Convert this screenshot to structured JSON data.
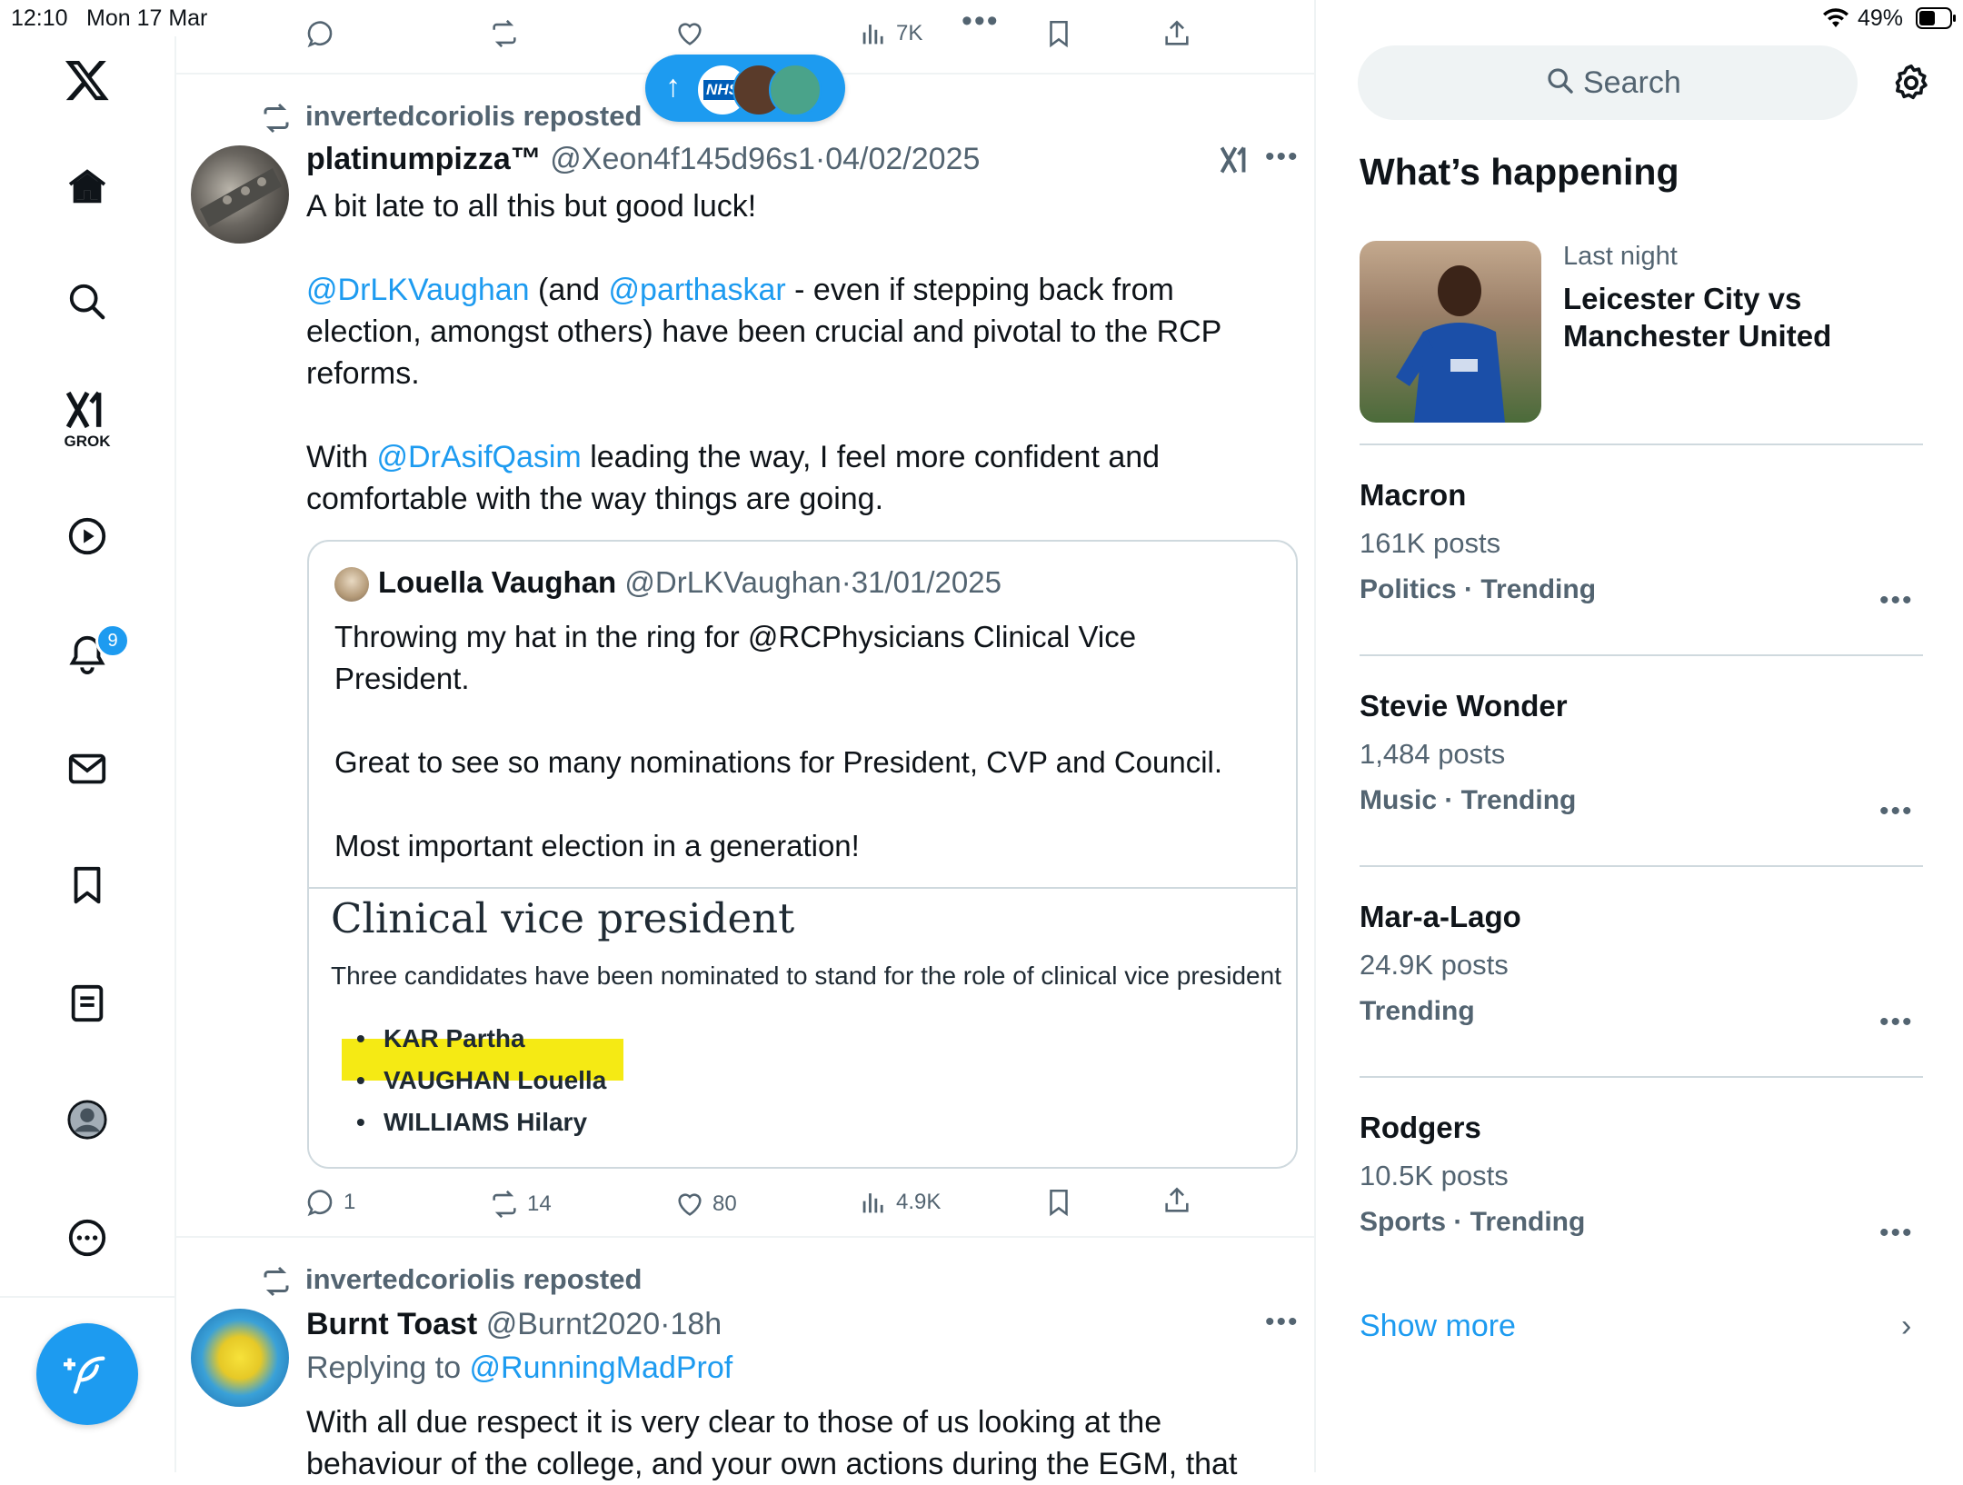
{
  "status_bar": {
    "time": "12:10",
    "date": "Mon 17 Mar",
    "battery": "49%"
  },
  "sidebar": {
    "grok_label": "GROK",
    "notifications_badge": "9"
  },
  "top_tweet_actions": {
    "views": "7K"
  },
  "new_posts_pill": {
    "arrow": "↑",
    "badge_text": "NHS"
  },
  "tweet1": {
    "repost_label": "invertedcoriolis reposted",
    "name": "platinumpizza™",
    "handle": "@Xeon4f145d96s1",
    "sep": "·",
    "date": "04/02/2025",
    "para1": "A bit late to all this but good luck!",
    "mention1": "@DrLKVaughan",
    "text_and": " (and ",
    "mention2": "@parthaskar",
    "text_rest1": " - even if stepping back from",
    "line2": "election, amongst others) have been crucial and pivotal to the RCP",
    "line3": "reforms.",
    "text_with": "With ",
    "mention3": "@DrAsifQasim",
    "text_leading": " leading the way, I feel more confident and",
    "line5": "comfortable with the way things are going.",
    "quote": {
      "name": "Louella Vaughan",
      "handle": "@DrLKVaughan",
      "sep": "·",
      "date": "31/01/2025",
      "line1": "Throwing my hat in the ring for @RCPhysicians Clinical Vice",
      "line2": "President.",
      "line3": "Great to see so many nominations for President, CVP and Council.",
      "line4": "Most important election in a generation!",
      "image": {
        "heading": "Clinical vice president",
        "subtitle": "Three candidates have been nominated to stand for the role of clinical vice president",
        "candidates": [
          "KAR Partha",
          "VAUGHAN Louella",
          "WILLIAMS Hilary"
        ],
        "highlight_color": "#f5ea14"
      }
    },
    "actions": {
      "replies": "1",
      "reposts": "14",
      "likes": "80",
      "views": "4.9K"
    }
  },
  "tweet2": {
    "repost_label": "invertedcoriolis reposted",
    "name": "Burnt Toast",
    "handle": "@Burnt2020",
    "sep": "·",
    "time": "18h",
    "replying_prefix": "Replying to ",
    "replying_to": "@RunningMadProf",
    "line1": "With all due respect it is very clear to those of us looking at the",
    "line2": "behaviour of the college, and your own actions during the EGM, that"
  },
  "right": {
    "search_placeholder": "Search",
    "whats_happening": "What’s happening",
    "featured": {
      "time": "Last night",
      "title_line1": "Leicester City vs",
      "title_line2": "Manchester United"
    },
    "trends": [
      {
        "title": "Macron",
        "count": "161K posts",
        "category": "Politics · Trending"
      },
      {
        "title": "Stevie Wonder",
        "count": "1,484 posts",
        "category": "Music · Trending"
      },
      {
        "title": "Mar-a-Lago",
        "count": "24.9K posts",
        "category": "Trending"
      },
      {
        "title": "Rodgers",
        "count": "10.5K posts",
        "category": "Sports · Trending"
      }
    ],
    "show_more": "Show more"
  },
  "colors": {
    "accent": "#1d9bf0",
    "muted": "#536471",
    "divider": "#eff3f4"
  }
}
